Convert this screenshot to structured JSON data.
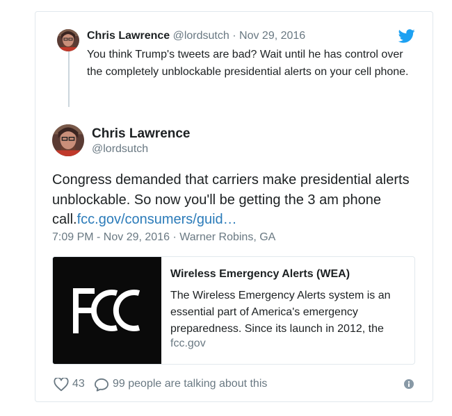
{
  "parent_tweet": {
    "name": "Chris Lawrence",
    "handle": "@lordsutch",
    "separator": "·",
    "date": "Nov 29, 2016",
    "text": "You think Trump's tweets are bad? Wait until he has control over the completely unblockable presidential alerts on your cell phone."
  },
  "main_tweet": {
    "name": "Chris Lawrence",
    "handle": "@lordsutch",
    "text": "Congress demanded that carriers make presidential alerts unblockable. So now you'll be getting the 3 am phone call.",
    "link_text": "fcc.gov/consumers/guid…",
    "time": "7:09 PM - Nov 29, 2016",
    "separator": "·",
    "location": "Warner Robins, GA"
  },
  "link_card": {
    "image_logo_text": "FCC",
    "title": "Wireless Emergency Alerts (WEA)",
    "description": "The Wireless Emergency Alerts system is an essential part of America's emergency preparedness. Since its launch in 2012, the",
    "domain": "fcc.gov"
  },
  "footer": {
    "likes": "43",
    "replies": "99 people are talking about this"
  },
  "icons": {
    "brand": "twitter-bird-icon",
    "like": "heart-icon",
    "reply": "speech-bubble-icon",
    "info": "info-icon"
  },
  "colors": {
    "twitter_blue": "#1da1f2",
    "link": "#2b7bb9",
    "muted": "#697882",
    "border": "#e1e8ed"
  }
}
